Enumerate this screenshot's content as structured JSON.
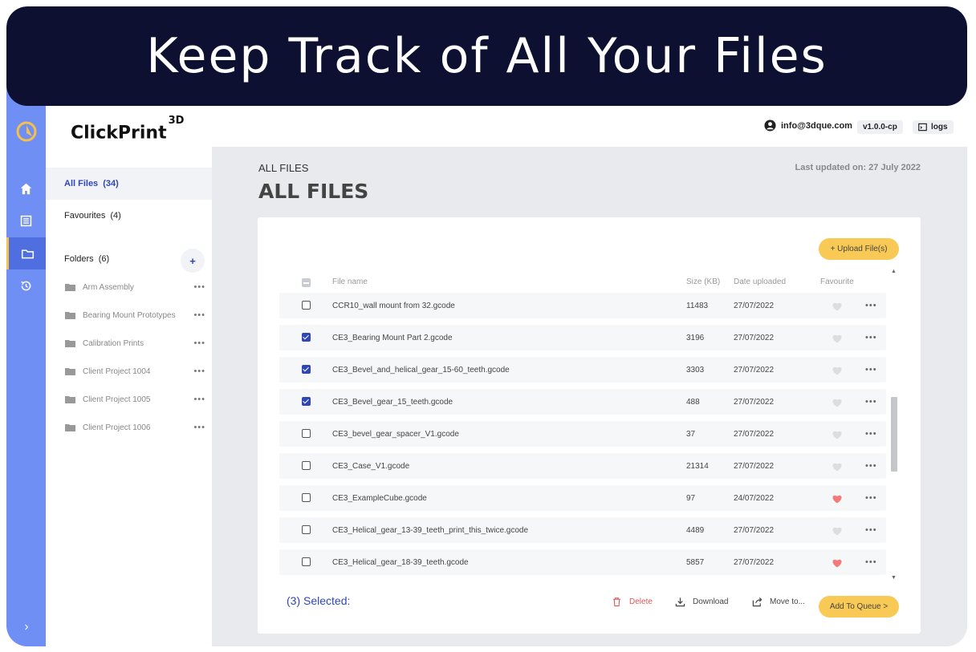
{
  "banner": {
    "title": "Keep Track of All Your Files"
  },
  "brand": {
    "name": "ClickPrint",
    "sup": "3D"
  },
  "header": {
    "user_email": "info@3dque.com",
    "version": "v1.0.0-cp",
    "logs_label": "logs"
  },
  "sidebar": {
    "all_files": {
      "label": "All Files",
      "count": "(34)"
    },
    "favourites": {
      "label": "Favourites",
      "count": "(4)"
    },
    "folders": {
      "label": "Folders",
      "count": "(6)",
      "add_label": "+"
    },
    "folder_items": [
      {
        "name": "Arm Assembly"
      },
      {
        "name": "Bearing Mount Prototypes"
      },
      {
        "name": "Calibration Prints"
      },
      {
        "name": "Client Project 1004"
      },
      {
        "name": "Client Project 1005"
      },
      {
        "name": "Client Project 1006"
      }
    ],
    "item_menu": "•••"
  },
  "main": {
    "breadcrumb": "ALL FILES",
    "title": "ALL FILES",
    "last_updated": "Last updated on: 27 July 2022",
    "upload_label": "+ Upload File(s)"
  },
  "table": {
    "headers": {
      "name": "File name",
      "size": "Size (KB)",
      "date": "Date uploaded",
      "favourite": "Favourite"
    },
    "rows": [
      {
        "name": "CCR10_wall mount from 32.gcode",
        "size": "11483",
        "date": "27/07/2022",
        "checked": false,
        "favourite": false
      },
      {
        "name": "CE3_Bearing Mount Part 2.gcode",
        "size": "3196",
        "date": "27/07/2022",
        "checked": true,
        "favourite": false
      },
      {
        "name": "CE3_Bevel_and_helical_gear_15-60_teeth.gcode",
        "size": "3303",
        "date": "27/07/2022",
        "checked": true,
        "favourite": false
      },
      {
        "name": "CE3_Bevel_gear_15_teeth.gcode",
        "size": "488",
        "date": "27/07/2022",
        "checked": true,
        "favourite": false
      },
      {
        "name": "CE3_bevel_gear_spacer_V1.gcode",
        "size": "37",
        "date": "27/07/2022",
        "checked": false,
        "favourite": false
      },
      {
        "name": "CE3_Case_V1.gcode",
        "size": "21314",
        "date": "27/07/2022",
        "checked": false,
        "favourite": false
      },
      {
        "name": "CE3_ExampleCube.gcode",
        "size": "97",
        "date": "24/07/2022",
        "checked": false,
        "favourite": true
      },
      {
        "name": "CE3_Helical_gear_13-39_teeth_print_this_twice.gcode",
        "size": "4489",
        "date": "27/07/2022",
        "checked": false,
        "favourite": false
      },
      {
        "name": "CE3_Helical_gear_18-39_teeth.gcode",
        "size": "5857",
        "date": "27/07/2022",
        "checked": false,
        "favourite": true
      }
    ],
    "row_menu": "•••"
  },
  "footer": {
    "selected": "(3) Selected:",
    "delete_label": "Delete",
    "download_label": "Download",
    "move_label": "Move to...",
    "queue_label": "Add To Queue >"
  },
  "colors": {
    "accent": "#2f47b5",
    "rail": "#6f8ff5",
    "button": "#f9c956",
    "heart_on": "#f47b7b",
    "heart_off": "#dcdde0",
    "delete": "#e25555",
    "banner": "#0d1030"
  }
}
